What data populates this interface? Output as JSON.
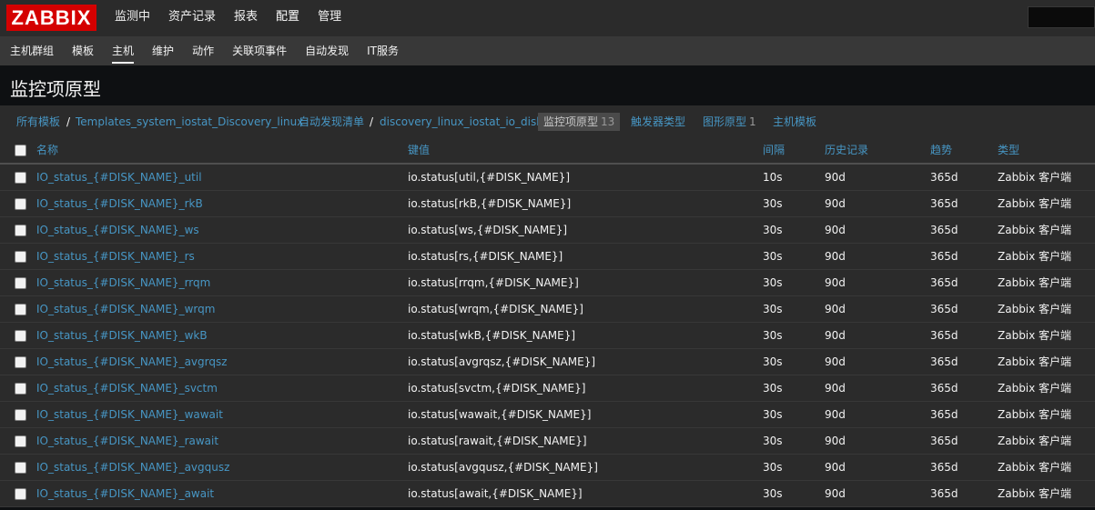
{
  "topbar": {
    "logo": "ZABBIX",
    "menu": [
      "监测中",
      "资产记录",
      "报表",
      "配置",
      "管理"
    ]
  },
  "submenu": [
    "主机群组",
    "模板",
    "主机",
    "维护",
    "动作",
    "关联项事件",
    "自动发现",
    "IT服务"
  ],
  "page_title": "监控项原型",
  "breadcrumb": {
    "all_templates": "所有模板",
    "sep": "/",
    "template": "Templates_system_iostat_Discovery_linux",
    "discovery_list": "自动发现清单",
    "discovery_rule": "discovery_linux_iostat_io_disk",
    "item_prototypes": "监控项原型",
    "item_prototypes_count": "13",
    "trigger_prototypes": "触发器类型",
    "graph_prototypes": "图形原型",
    "graph_prototypes_count": "1",
    "host_prototypes": "主机模板"
  },
  "table": {
    "columns": [
      "名称",
      "键值",
      "间隔",
      "历史记录",
      "趋势",
      "类型"
    ],
    "rows": [
      [
        "IO_status_{#DISK_NAME}_util",
        "io.status[util,{#DISK_NAME}]",
        "10s",
        "90d",
        "365d",
        "Zabbix 客户端"
      ],
      [
        "IO_status_{#DISK_NAME}_rkB",
        "io.status[rkB,{#DISK_NAME}]",
        "30s",
        "90d",
        "365d",
        "Zabbix 客户端"
      ],
      [
        "IO_status_{#DISK_NAME}_ws",
        "io.status[ws,{#DISK_NAME}]",
        "30s",
        "90d",
        "365d",
        "Zabbix 客户端"
      ],
      [
        "IO_status_{#DISK_NAME}_rs",
        "io.status[rs,{#DISK_NAME}]",
        "30s",
        "90d",
        "365d",
        "Zabbix 客户端"
      ],
      [
        "IO_status_{#DISK_NAME}_rrqm",
        "io.status[rrqm,{#DISK_NAME}]",
        "30s",
        "90d",
        "365d",
        "Zabbix 客户端"
      ],
      [
        "IO_status_{#DISK_NAME}_wrqm",
        "io.status[wrqm,{#DISK_NAME}]",
        "30s",
        "90d",
        "365d",
        "Zabbix 客户端"
      ],
      [
        "IO_status_{#DISK_NAME}_wkB",
        "io.status[wkB,{#DISK_NAME}]",
        "30s",
        "90d",
        "365d",
        "Zabbix 客户端"
      ],
      [
        "IO_status_{#DISK_NAME}_avgrqsz",
        "io.status[avgrqsz,{#DISK_NAME}]",
        "30s",
        "90d",
        "365d",
        "Zabbix 客户端"
      ],
      [
        "IO_status_{#DISK_NAME}_svctm",
        "io.status[svctm,{#DISK_NAME}]",
        "30s",
        "90d",
        "365d",
        "Zabbix 客户端"
      ],
      [
        "IO_status_{#DISK_NAME}_wawait",
        "io.status[wawait,{#DISK_NAME}]",
        "30s",
        "90d",
        "365d",
        "Zabbix 客户端"
      ],
      [
        "IO_status_{#DISK_NAME}_rawait",
        "io.status[rawait,{#DISK_NAME}]",
        "30s",
        "90d",
        "365d",
        "Zabbix 客户端"
      ],
      [
        "IO_status_{#DISK_NAME}_avgqusz",
        "io.status[avgqusz,{#DISK_NAME}]",
        "30s",
        "90d",
        "365d",
        "Zabbix 客户端"
      ],
      [
        "IO_status_{#DISK_NAME}_await",
        "io.status[await,{#DISK_NAME}]",
        "30s",
        "90d",
        "365d",
        "Zabbix 客户端"
      ]
    ]
  },
  "colors": {
    "brand_red": "#d40000",
    "link_blue": "#4796c4",
    "text": "#f2f2f2"
  }
}
